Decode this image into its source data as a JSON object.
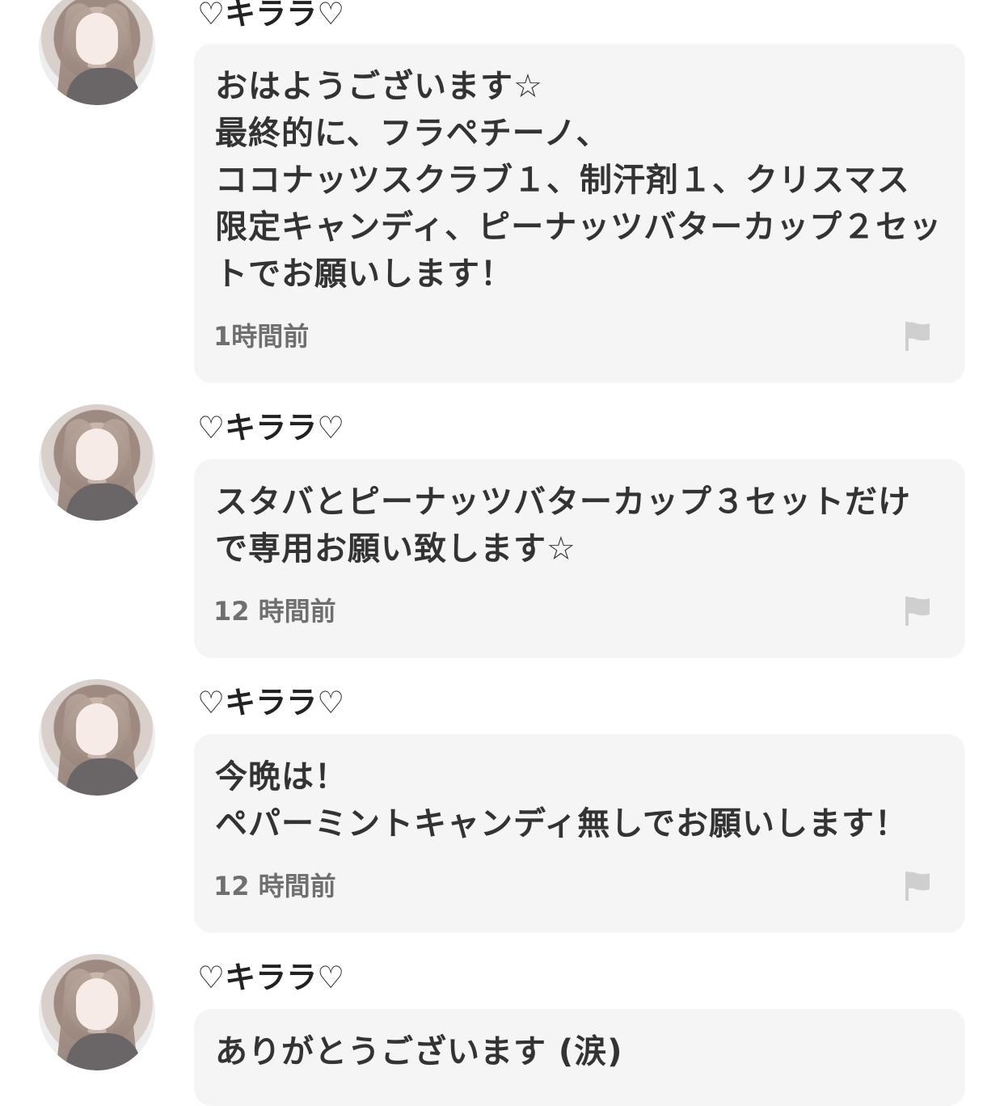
{
  "comments": [
    {
      "username": "♡キララ♡",
      "text": "おはようございます☆\n最終的に、フラペチーノ、\nココナッツスクラブ１、制汗剤１、クリスマス限定キャンディ、ピーナッツバターカップ２セットでお願いします！",
      "time": "1時間前",
      "avatar": "user-avatar",
      "flag_icon": "flag-icon"
    },
    {
      "username": "♡キララ♡",
      "text": "スタバとピーナッツバターカップ３セットだけで専用お願い致します☆",
      "time": "12 時間前",
      "avatar": "user-avatar",
      "flag_icon": "flag-icon"
    },
    {
      "username": "♡キララ♡",
      "text": "今晩は！\nペパーミントキャンディ無しでお願いします！",
      "time": "12 時間前",
      "avatar": "user-avatar",
      "flag_icon": "flag-icon"
    },
    {
      "username": "♡キララ♡",
      "text": "ありがとうございます (涙)",
      "time": "",
      "avatar": "user-avatar",
      "flag_icon": "flag-icon"
    }
  ],
  "colors": {
    "bubble_background": "#f5f5f5",
    "text": "#333333",
    "timestamp": "#6f6f6f",
    "flag": "#cfcfcf"
  }
}
